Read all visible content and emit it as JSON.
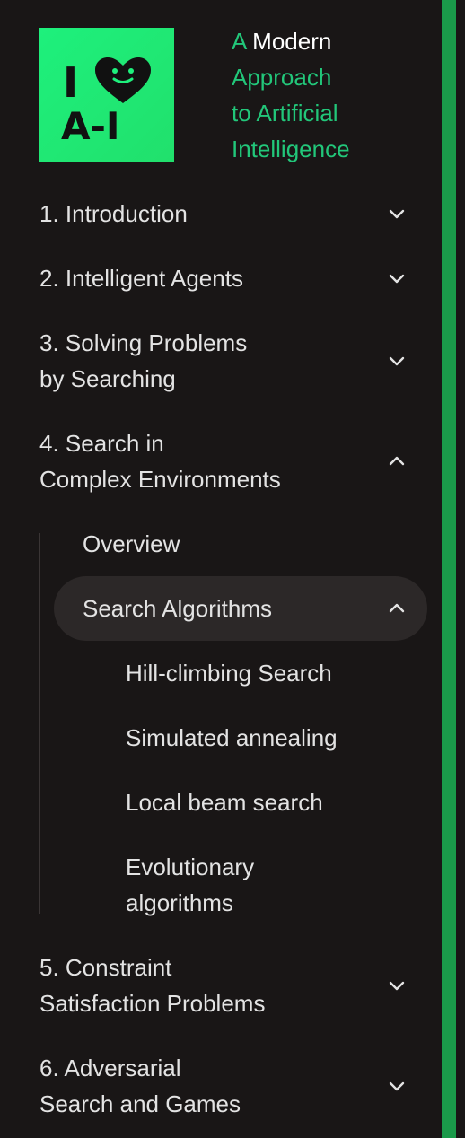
{
  "brand": {
    "title_part1": "A",
    "title_part2": "Modern",
    "title_line2": "Approach",
    "title_line3": "to Artificial",
    "title_line4": "Intelligence",
    "logo_text_top": "I",
    "logo_text_bottom": "A-I",
    "logo_color": "#1ef07c",
    "accent_color": "#22c77a"
  },
  "nav": {
    "ch1": {
      "label": "1. Introduction",
      "icon": "chevron-down-icon"
    },
    "ch2": {
      "label": "2. Intelligent Agents",
      "icon": "chevron-down-icon"
    },
    "ch3": {
      "line1": "3. Solving Problems",
      "line2": "by Searching",
      "icon": "chevron-down-icon"
    },
    "ch4": {
      "line1": "4. Search in",
      "line2": "Complex Environments",
      "icon": "chevron-up-icon"
    },
    "ch4_sub": {
      "overview": "Overview",
      "search_algorithms": {
        "label": "Search Algorithms",
        "icon": "chevron-up-icon"
      },
      "items": [
        {
          "line1": "Hill-climbing Search"
        },
        {
          "line1": "Simulated annealing"
        },
        {
          "line1": "Local beam search"
        },
        {
          "line1": "Evolutionary",
          "line2": "algorithms"
        }
      ]
    },
    "ch5": {
      "line1": "5. Constraint",
      "line2": "Satisfaction Problems",
      "icon": "chevron-down-icon"
    },
    "ch6": {
      "line1": "6. Adversarial",
      "line2": "Search and Games",
      "icon": "chevron-down-icon"
    }
  },
  "colors": {
    "background": "#191616",
    "text": "#e3e3e3",
    "active_bg": "#2c2828",
    "scroll_accent": "#1a9a4a"
  }
}
